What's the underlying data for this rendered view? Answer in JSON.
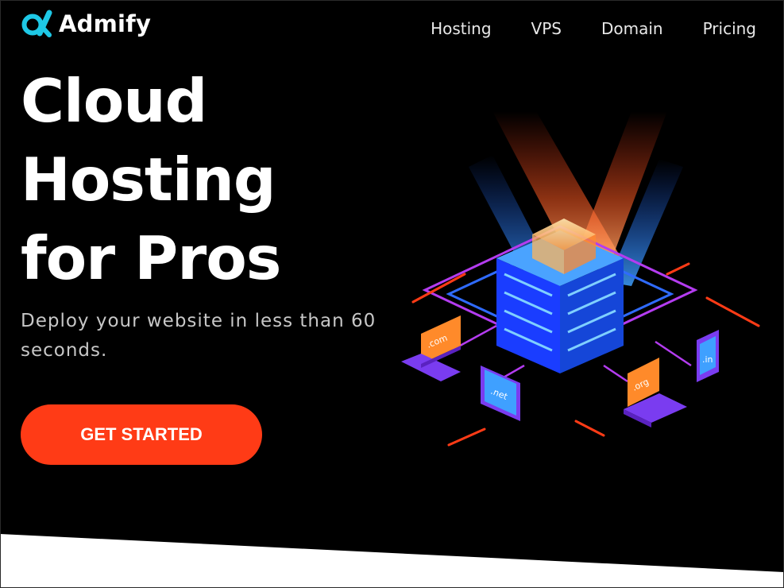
{
  "brand": {
    "name": "Admify"
  },
  "nav": {
    "items": [
      "Hosting",
      "VPS",
      "Domain",
      "Pricing"
    ]
  },
  "hero": {
    "title_lines": [
      "Cloud",
      "Hosting",
      "for Pros"
    ],
    "subtitle": "Deploy your website in less than 60 seconds.",
    "cta_label": "GET STARTED"
  },
  "illustration": {
    "domain_labels": [
      ".com",
      ".net",
      ".org",
      ".in"
    ]
  },
  "colors": {
    "background": "#000000",
    "accent": "#ff3b16",
    "logo": "#1ec8e6",
    "server_blue": "#1a5cff",
    "laptop_purple": "#7a3cf0"
  },
  "icons": [
    "logo-mark-icon"
  ]
}
